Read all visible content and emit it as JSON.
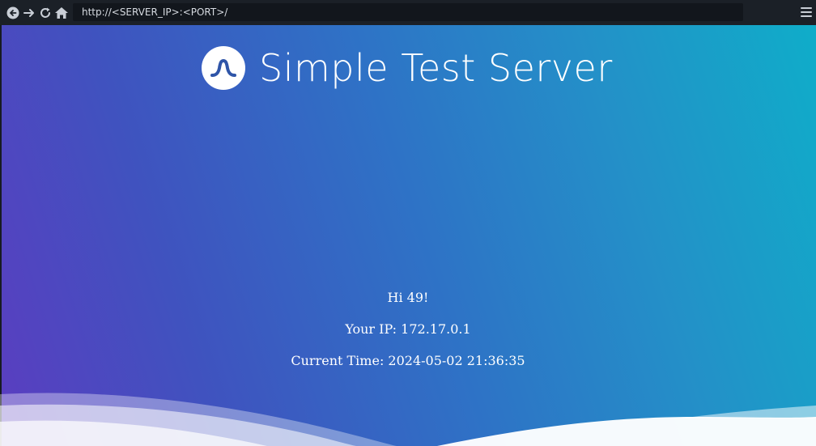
{
  "browser": {
    "url": "http://<SERVER_IP>:<PORT>/",
    "back_icon": "back-arrow-circle-icon",
    "forward_icon": "forward-arrow-icon",
    "reload_icon": "reload-icon",
    "home_icon": "home-icon",
    "menu_icon": "hamburger-menu-icon"
  },
  "page": {
    "title": "Simple Test Server",
    "logo_icon": "wave-logo-icon",
    "greeting": "Hi 49!",
    "ip_line": "Your IP: 172.17.0.1",
    "time_line": "Current Time: 2024-05-02 21:36:35"
  },
  "colors": {
    "gradient_start": "#5b3dc0",
    "gradient_end": "#0fadc9",
    "toolbar_bg": "#1b2027",
    "text": "#ffffff"
  }
}
